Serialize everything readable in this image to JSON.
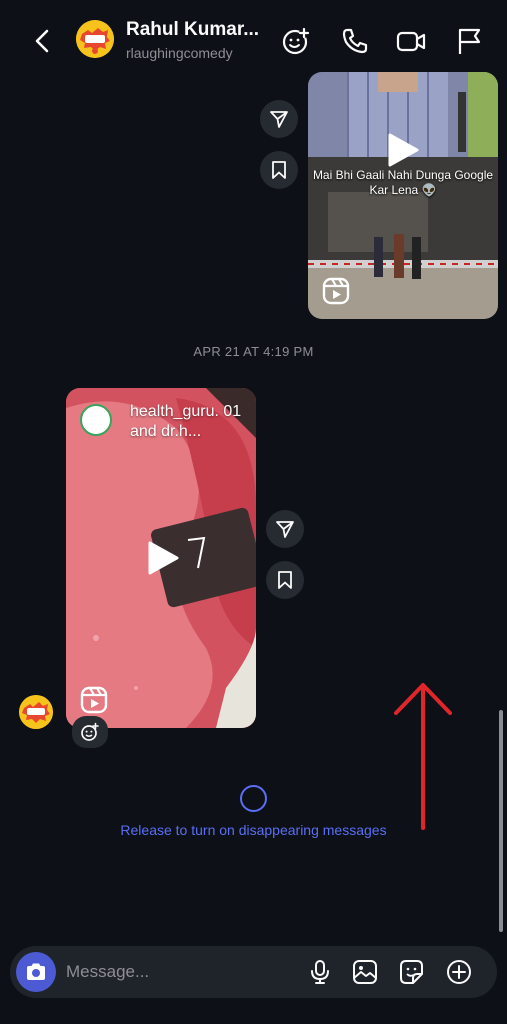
{
  "header": {
    "title": "Rahul Kumar...",
    "subtitle": "rlaughingcomedy",
    "icons": [
      "back-icon",
      "effects-icon",
      "phone-icon",
      "video-call-icon",
      "flag-icon"
    ]
  },
  "messages": {
    "reel1": {
      "caption": "Mai Bhi Gaali Nahi Dunga Google Kar Lena 👽"
    },
    "timestamp": "APR 21 AT 4:19 PM",
    "reel2": {
      "username": "health_guru. 01 and dr.h..."
    }
  },
  "disappearing": {
    "text": "Release to turn on disappearing messages"
  },
  "composer": {
    "placeholder": "Message..."
  },
  "colors": {
    "background": "#0d1117",
    "accent": "#5b6ef5",
    "arrow": "#e0262b"
  }
}
